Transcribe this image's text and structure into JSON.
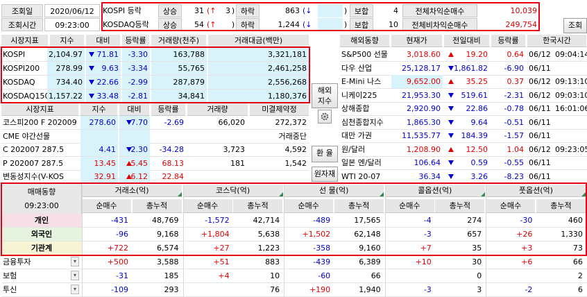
{
  "top": {
    "date_label": "조회일",
    "date": "2020/06/12",
    "time_label": "조회시간",
    "time": "09:23:00",
    "kospi_label": "KOSPI 등락",
    "kosdaq_label": "KOSDAQ등락",
    "up_label": "상승",
    "limit_up": "(↑",
    "close_paren": ")",
    "down_label": "하락",
    "down_arrow": "(↓",
    "flat_label": "보합",
    "kospi": {
      "up": "31",
      "limit_up": "3",
      "down": "863",
      "flat": "4"
    },
    "kosdaq": {
      "up": "54",
      "limit_up": "",
      "down": "1,244",
      "flat": "10"
    },
    "arb_label": "전체차익순매수",
    "arb": "10,039",
    "narb_label": "전체비차익순매수",
    "narb": "249,754",
    "query_button": "조회"
  },
  "indices": {
    "headers": [
      "시장지표",
      "지수",
      "대비",
      "등락률",
      "거래량(천주)",
      "거래대금(백만)"
    ],
    "rows": [
      {
        "name": "KOSPI",
        "index": "2,104.97",
        "chg": "71.81",
        "dir": "down",
        "rate": "-3.30",
        "vol": "163,788",
        "amt": "3,321,181"
      },
      {
        "name": "KOSPI200",
        "index": "278.99",
        "chg": "9.63",
        "dir": "down",
        "rate": "-3.34",
        "vol": "55,765",
        "amt": "2,461,258"
      },
      {
        "name": "KOSDAQ",
        "index": "734.40",
        "chg": "22.66",
        "dir": "down",
        "rate": "-2.99",
        "vol": "287,879",
        "amt": "2,556,268"
      },
      {
        "name": "KOSDAQ150",
        "index": "1,157.22",
        "chg": "33.48",
        "dir": "down",
        "rate": "-2.81",
        "vol": "34,841",
        "amt": "1,180,376"
      }
    ]
  },
  "derivs": {
    "headers": [
      "시장지표",
      "지수",
      "대비",
      "등락률",
      "거래량",
      "미결제약정"
    ],
    "rows": [
      {
        "name": "코스피200 F 202009",
        "index": "278.60",
        "chg": "7.70",
        "dir": "down",
        "rate": "-2.69",
        "vol": "66,020",
        "oi": "272,372",
        "color": "blue"
      },
      {
        "name": "CME 야간선물",
        "index": "",
        "chg": "",
        "dir": "",
        "rate": "",
        "vol": "",
        "oi": "거래중단",
        "color": ""
      },
      {
        "name": "C 202007 287.5",
        "index": "4.41",
        "chg": "2.30",
        "dir": "down",
        "rate": "-34.28",
        "vol": "3,723",
        "oi": "4,592",
        "color": "blue"
      },
      {
        "name": "P 202007 287.5",
        "index": "13.45",
        "chg": "5.45",
        "dir": "up",
        "rate": "68.13",
        "vol": "181",
        "oi": "1,542",
        "color": "red"
      },
      {
        "name": "변동성지수(V-KOS",
        "index": "32.91",
        "chg": "6.12",
        "dir": "up",
        "rate": "22.84",
        "vol": "",
        "oi": "",
        "color": "red"
      }
    ]
  },
  "side_buttons": {
    "overseas": "해외\n지수",
    "gear": "gear-icon",
    "fx": "환 율",
    "raw": "원자재"
  },
  "world": {
    "headers": [
      "해외동향",
      "현재가",
      "전일대비",
      "등락률",
      "한국시간"
    ],
    "rows": [
      {
        "name": "S&P500 선물",
        "price": "3,018.60",
        "dir": "up",
        "chg": "19.20",
        "rate": "0.64",
        "date": "06/12",
        "time": "09:04:14",
        "color": "red"
      },
      {
        "name": "다우 산업",
        "price": "25,128.17",
        "dir": "down",
        "chg": "1,861.82",
        "rate": "-6.90",
        "date": "06/11",
        "time": "",
        "color": "blue"
      },
      {
        "name": "E-Mini 나스",
        "price": "9,652.00",
        "dir": "up",
        "chg": "35.25",
        "rate": "0.37",
        "date": "06/12",
        "time": "09:13:10",
        "color": "red"
      },
      {
        "name": "니케이225",
        "price": "21,953.30",
        "dir": "down",
        "chg": "519.61",
        "rate": "-2.31",
        "date": "06/12",
        "time": "09:03:10",
        "color": "blue"
      },
      {
        "name": "상해종합",
        "price": "2,920.90",
        "dir": "down",
        "chg": "22.86",
        "rate": "-0.78",
        "date": "06/11",
        "time": "16:01:06",
        "color": "blue"
      },
      {
        "name": "심천종합지수",
        "price": "1,865.30",
        "dir": "down",
        "chg": "9.64",
        "rate": "-0.51",
        "date": "06/11",
        "time": "",
        "color": "blue"
      },
      {
        "name": "대만 가권",
        "price": "11,535.77",
        "dir": "down",
        "chg": "184.39",
        "rate": "-1.57",
        "date": "06/11",
        "time": "",
        "color": "blue"
      },
      {
        "name": "원/달러",
        "price": "1,208.90",
        "dir": "up",
        "chg": "12.50",
        "rate": "1.04",
        "date": "06/12",
        "time": "09:23:05",
        "color": "red"
      },
      {
        "name": "일본 엔/달러",
        "price": "106.64",
        "dir": "down",
        "chg": "0.59",
        "rate": "-0.55",
        "date": "06/11",
        "time": "",
        "color": "blue"
      },
      {
        "name": "WTI 20-07",
        "price": "36.34",
        "dir": "down",
        "chg": "3.26",
        "rate": "-8.23",
        "date": "06/11",
        "time": "",
        "color": "blue"
      }
    ]
  },
  "flow": {
    "title": "매매동향",
    "time": "09:23:00",
    "groups": [
      "거래소(억)",
      "코스닥(억)",
      "선 물(억)",
      "콜옵션(억)",
      "풋옵션(억)"
    ],
    "sub": [
      "순매수",
      "총누적"
    ],
    "rows": [
      {
        "name": "개인",
        "vals": [
          "-431",
          "48,769",
          "-1,572",
          "42,714",
          "-489",
          "17,565",
          "-4",
          "274",
          "-30",
          "460"
        ]
      },
      {
        "name": "외국인",
        "vals": [
          "-96",
          "9,168",
          "+1,804",
          "5,638",
          "+1,502",
          "62,148",
          "-3",
          "657",
          "+26",
          "1,330"
        ]
      },
      {
        "name": "기관계",
        "vals": [
          "+722",
          "6,574",
          "+27",
          "1,223",
          "-358",
          "9,160",
          "+7",
          "35",
          "+3",
          "73"
        ]
      },
      {
        "name": "금융투자",
        "vals": [
          "+500",
          "3,588",
          "+51",
          "883",
          "-439",
          "6,389",
          "+10",
          "30",
          "+6",
          "66"
        ]
      },
      {
        "name": "보험",
        "vals": [
          "-31",
          "185",
          "+4",
          "10",
          "-60",
          "66",
          "",
          "0",
          "",
          "2"
        ]
      },
      {
        "name": "투신",
        "vals": [
          "-109",
          "293",
          "",
          "76",
          "+190",
          "1,940",
          "-3",
          "3",
          "-2",
          "6"
        ]
      }
    ]
  },
  "colors": {
    "highlight": "#e60012",
    "cyan": "#d9f3fb",
    "up": "#e00000",
    "down": "#0000d0"
  }
}
